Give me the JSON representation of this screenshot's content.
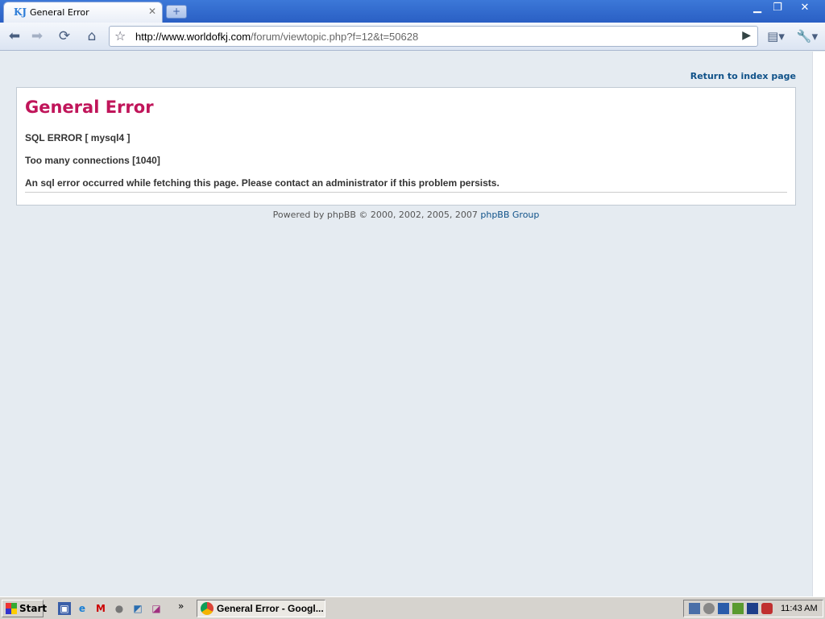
{
  "browser": {
    "tab_title": "General Error",
    "tab_favicon": "KJ",
    "url_host": "http://www.worldofkj.com",
    "url_path": "/forum/viewtopic.php?f=12&t=50628"
  },
  "page": {
    "return_link": "Return to index page",
    "error_title": "General Error",
    "line1": "SQL ERROR [ mysql4 ]",
    "line2": "Too many connections [1040]",
    "line3": "An sql error occurred while fetching this page. Please contact an administrator if this problem persists.",
    "footer_text": "Powered by phpBB © 2000, 2002, 2005, 2007 ",
    "footer_link": "phpBB Group"
  },
  "taskbar": {
    "start_label": "Start",
    "task_label": "General Error - Googl...",
    "clock": "11:43 AM"
  }
}
